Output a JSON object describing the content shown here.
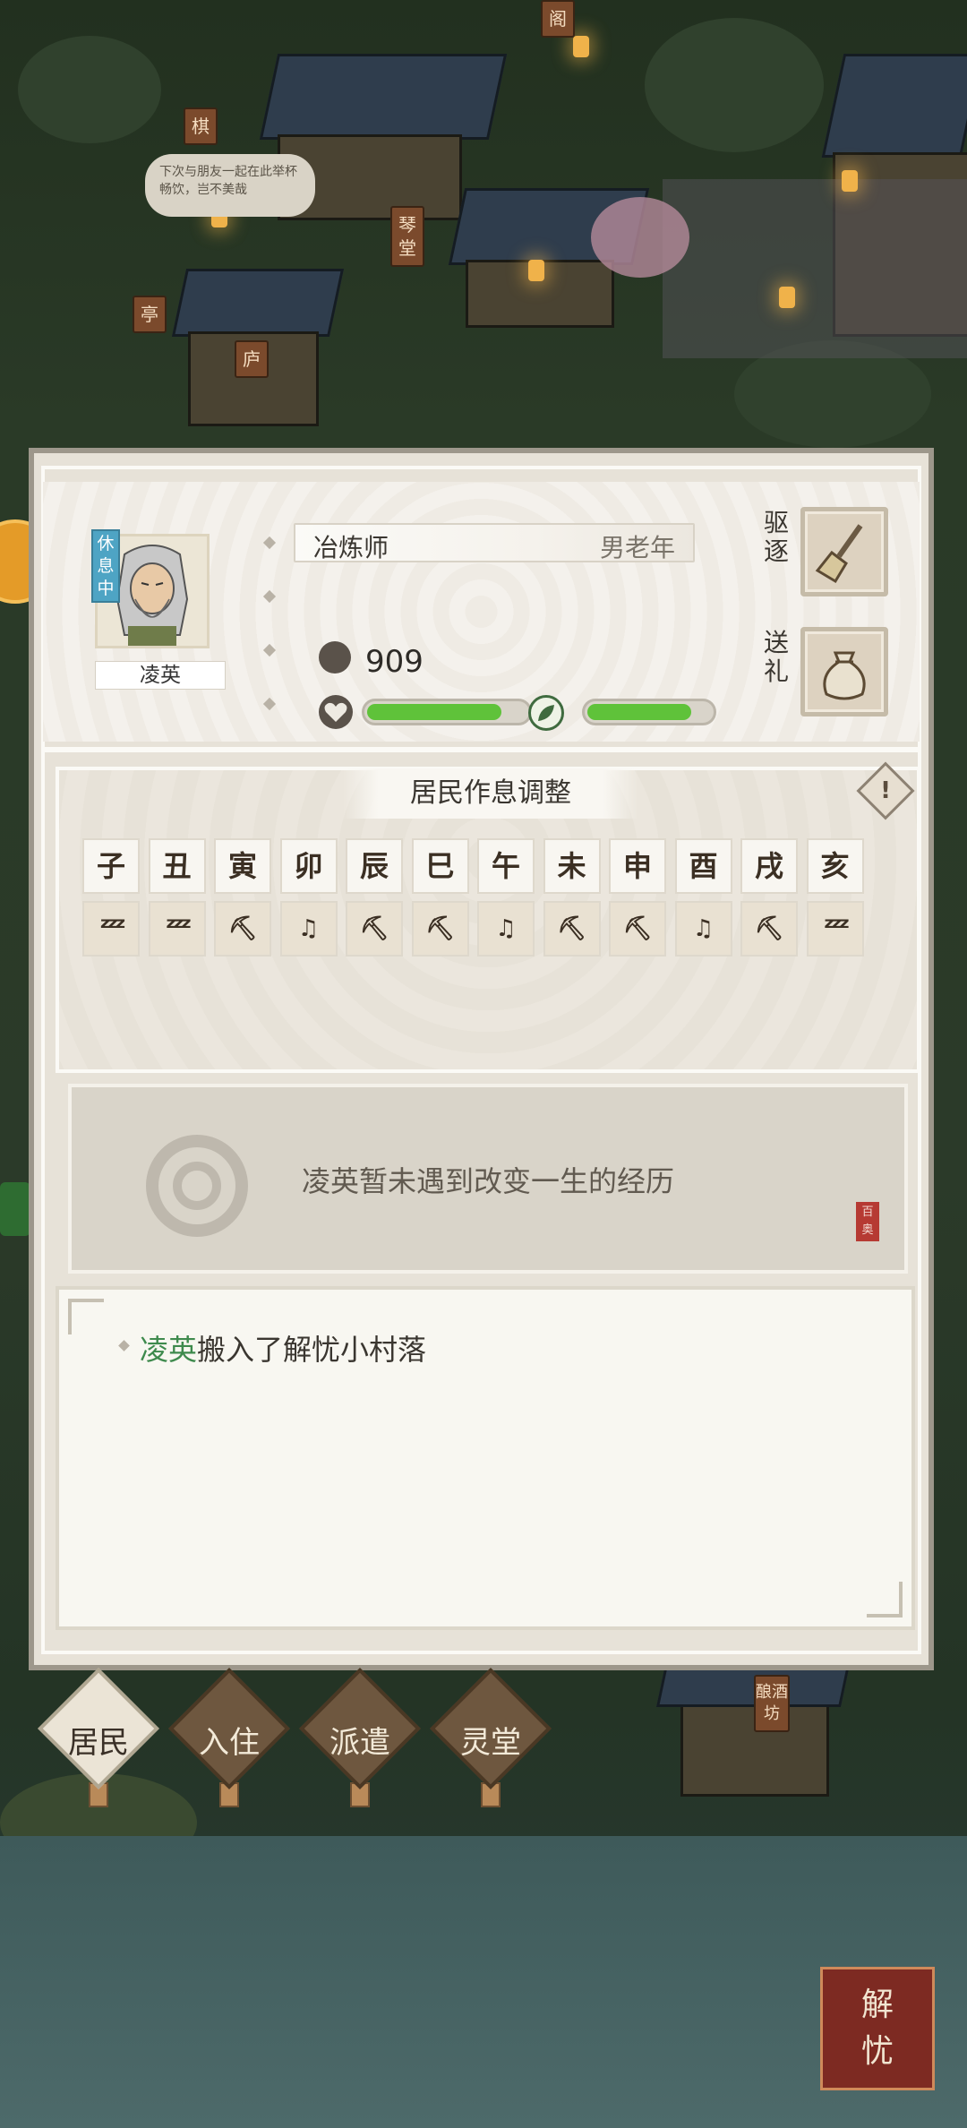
{
  "scene": {
    "speech_bubble": "下次与朋友一起在此举杯畅饮，岂不美哉",
    "signs": [
      "棋",
      "亭",
      "庐",
      "琴堂",
      "阁",
      "酿酒坊"
    ],
    "corner_button": {
      "top": "解",
      "bottom": "忧"
    }
  },
  "resident": {
    "status_tag": "休息中",
    "name": "凌英",
    "job": "冶炼师",
    "sex_age": "男老年",
    "money": "909",
    "health_level": 0.85,
    "mood_level": 0.85,
    "actions": {
      "expel": "驱逐",
      "gift": "送礼"
    }
  },
  "schedule": {
    "title": "居民作息调整",
    "warn_symbol": "!",
    "hours": [
      "子",
      "丑",
      "寅",
      "卯",
      "辰",
      "巳",
      "午",
      "未",
      "申",
      "酉",
      "戌",
      "亥"
    ],
    "activities": [
      "sleep",
      "sleep",
      "work",
      "leisure",
      "work",
      "work",
      "leisure",
      "work",
      "work",
      "leisure",
      "work",
      "sleep"
    ],
    "glyphs": {
      "sleep": "ᶻᶻᶻ",
      "work": "⛏",
      "leisure": "♫"
    }
  },
  "experience": {
    "text": "凌英暂未遇到改变一生的经历",
    "stamp": "百奥"
  },
  "log": {
    "name": "凌英",
    "text": "搬入了解忧小村落"
  },
  "tabs": [
    {
      "label": "居民",
      "active": true
    },
    {
      "label": "入住",
      "active": false
    },
    {
      "label": "派遣",
      "active": false
    },
    {
      "label": "灵堂",
      "active": false
    }
  ],
  "colors": {
    "panel_bg": "#e7e2d8",
    "bar_fill": "#5fc23a",
    "status_tag": "#4ea4c4",
    "log_name": "#3e8a4d"
  }
}
